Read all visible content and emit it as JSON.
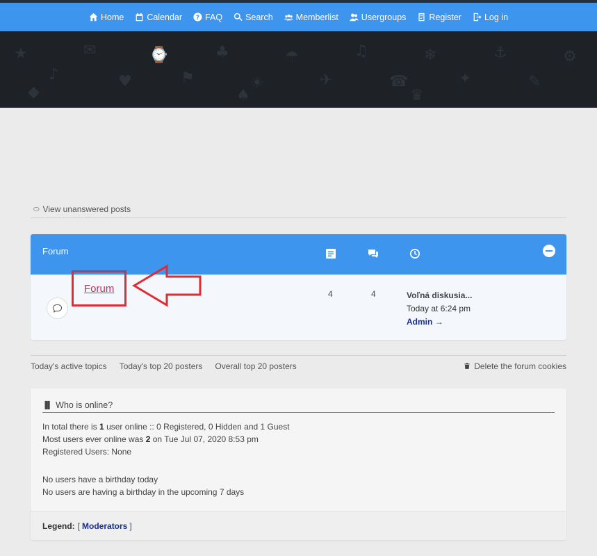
{
  "nav": {
    "items": [
      {
        "label": "Home",
        "icon": "home-icon"
      },
      {
        "label": "Calendar",
        "icon": "calendar-icon"
      },
      {
        "label": "FAQ",
        "icon": "question-icon"
      },
      {
        "label": "Search",
        "icon": "search-icon"
      },
      {
        "label": "Memberlist",
        "icon": "members-icon"
      },
      {
        "label": "Usergroups",
        "icon": "usergroups-icon"
      },
      {
        "label": "Register",
        "icon": "register-icon"
      },
      {
        "label": "Log in",
        "icon": "login-icon"
      }
    ],
    "color": "#3d95ee"
  },
  "unanswered": {
    "label": "View unanswered posts"
  },
  "forum_section": {
    "header_title": "Forum",
    "row": {
      "name": "Forum",
      "topics": "4",
      "posts": "4",
      "last_post_title": "Voľná diskusia...",
      "last_post_time": "Today at 6:24 pm",
      "last_post_author": "Admin",
      "author_arrow": "→"
    }
  },
  "links": {
    "active_topics": "Today's active topics",
    "top_today": "Today's top 20 posters",
    "top_overall": "Overall top 20 posters",
    "delete_cookies": "Delete the forum cookies"
  },
  "online": {
    "title": "Who is online?",
    "line1_pre": "In total there is ",
    "line1_num": "1",
    "line1_post": " user online :: 0 Registered, 0 Hidden and 1 Guest",
    "line2_pre": "Most users ever online was ",
    "line2_num": "2",
    "line2_post": " on Tue Jul 07, 2020 8:53 pm",
    "line3": "Registered Users: None",
    "line4": "No users have a birthday today",
    "line5": "No users are having a birthday in the upcoming 7 days",
    "legend_label": "Legend:",
    "legend_open": "[",
    "legend_mod": "Moderators",
    "legend_close": "]"
  },
  "annotation_color": "#e32932"
}
